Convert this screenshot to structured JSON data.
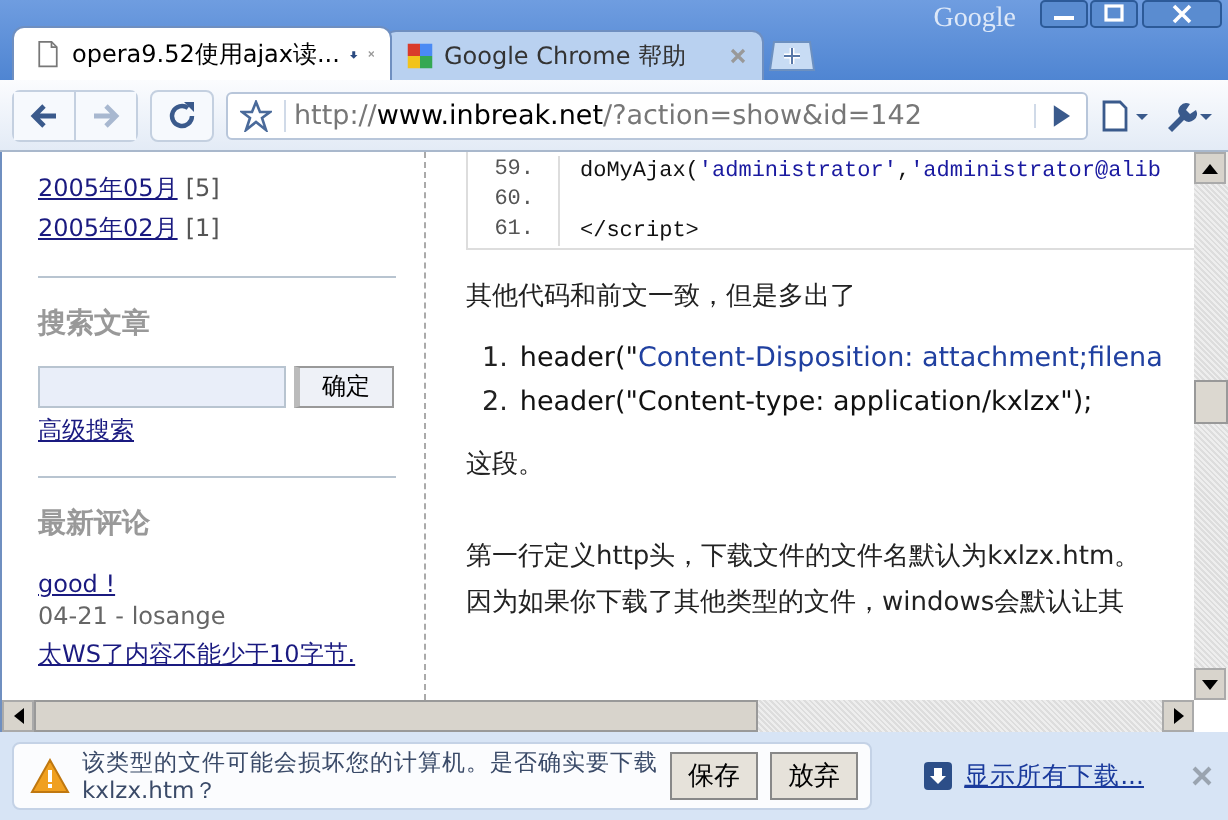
{
  "window": {
    "brand": "Google"
  },
  "tabs": [
    {
      "title": "opera9.52使用ajax读...",
      "selected": true,
      "kind": "page",
      "downloading": true
    },
    {
      "title": "Google Chrome 帮助",
      "selected": false,
      "kind": "site",
      "downloading": false
    }
  ],
  "toolbar": {
    "url": {
      "scheme": "http://",
      "host": "www.inbreak.net",
      "path": "/?action=show&id=142"
    }
  },
  "sidebar": {
    "archives": [
      {
        "label": "2005年05月",
        "count": "[5]"
      },
      {
        "label": "2005年02月",
        "count": "[1]"
      }
    ],
    "search": {
      "heading": "搜索文章",
      "button": "确定",
      "advanced": "高级搜索"
    },
    "comments": {
      "heading": "最新评论",
      "items": [
        {
          "kind": "link",
          "text": "good !"
        },
        {
          "kind": "meta",
          "text": "04-21 - losange"
        },
        {
          "kind": "link",
          "text": "太WS了内容不能少于10字节."
        }
      ]
    }
  },
  "article": {
    "code_lines": [
      {
        "number": "59.",
        "tokens": [
          {
            "kind": "plain",
            "text": "doMyAjax("
          },
          {
            "kind": "string",
            "text": "'administrator'"
          },
          {
            "kind": "plain",
            "text": ","
          },
          {
            "kind": "string",
            "text": "'administrator@alib"
          }
        ]
      },
      {
        "number": "60."
      },
      {
        "number": "61.",
        "tokens": [
          {
            "kind": "plain",
            "text": "</script>"
          }
        ]
      }
    ],
    "intro": "其他代码和前文一致，但是多出了",
    "list": [
      {
        "number": "1.",
        "tokens": [
          {
            "kind": "plain",
            "text": "header(\""
          },
          {
            "kind": "string",
            "text": "Content-Disposition: attachment;filena"
          }
        ]
      },
      {
        "number": "2.",
        "tokens": [
          {
            "kind": "plain",
            "text": "header(\"Content-type: application/kxlzx\");"
          }
        ]
      }
    ],
    "after": "这段。",
    "paragraph_lines": [
      "第一行定义http头，下载文件的文件名默认为kxlzx.htm。",
      "因为如果你下载了其他类型的文件，windows会默认让其"
    ]
  },
  "download_bar": {
    "warning": "该类型的文件可能会损坏您的计算机。是否确实要下载",
    "filename": "kxlzx.htm？",
    "buttons": [
      "保存",
      "放弃"
    ],
    "show_all": "显示所有下载..."
  }
}
